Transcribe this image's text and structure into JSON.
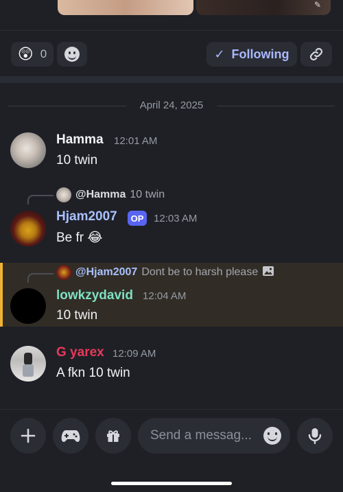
{
  "reactions": {
    "emoji": "😲",
    "count": "0"
  },
  "follow_button": {
    "label": "Following"
  },
  "date_separator": "April 24, 2025",
  "messages": [
    {
      "author": "Hamma",
      "author_color": "#f2f3f5",
      "time": "12:01 AM",
      "text": "10 twin"
    },
    {
      "reply_to": "@Hamma",
      "reply_snippet": "10 twin",
      "author": "Hjam2007",
      "author_color": "#a9c0ff",
      "badge": "OP",
      "time": "12:03 AM",
      "text": "Be fr",
      "emoji": "😂"
    },
    {
      "reply_to": "@Hjam2007",
      "reply_snippet": "Dont be to harsh please",
      "author": "lowkzydavid",
      "author_color": "#7fe0c3",
      "time": "12:04 AM",
      "text": "10 twin"
    },
    {
      "author": "G yarex",
      "author_color": "#e8395a",
      "time": "12:09 AM",
      "text": "A fkn 10 twin"
    }
  ],
  "composer": {
    "placeholder": "Send a messag..."
  }
}
